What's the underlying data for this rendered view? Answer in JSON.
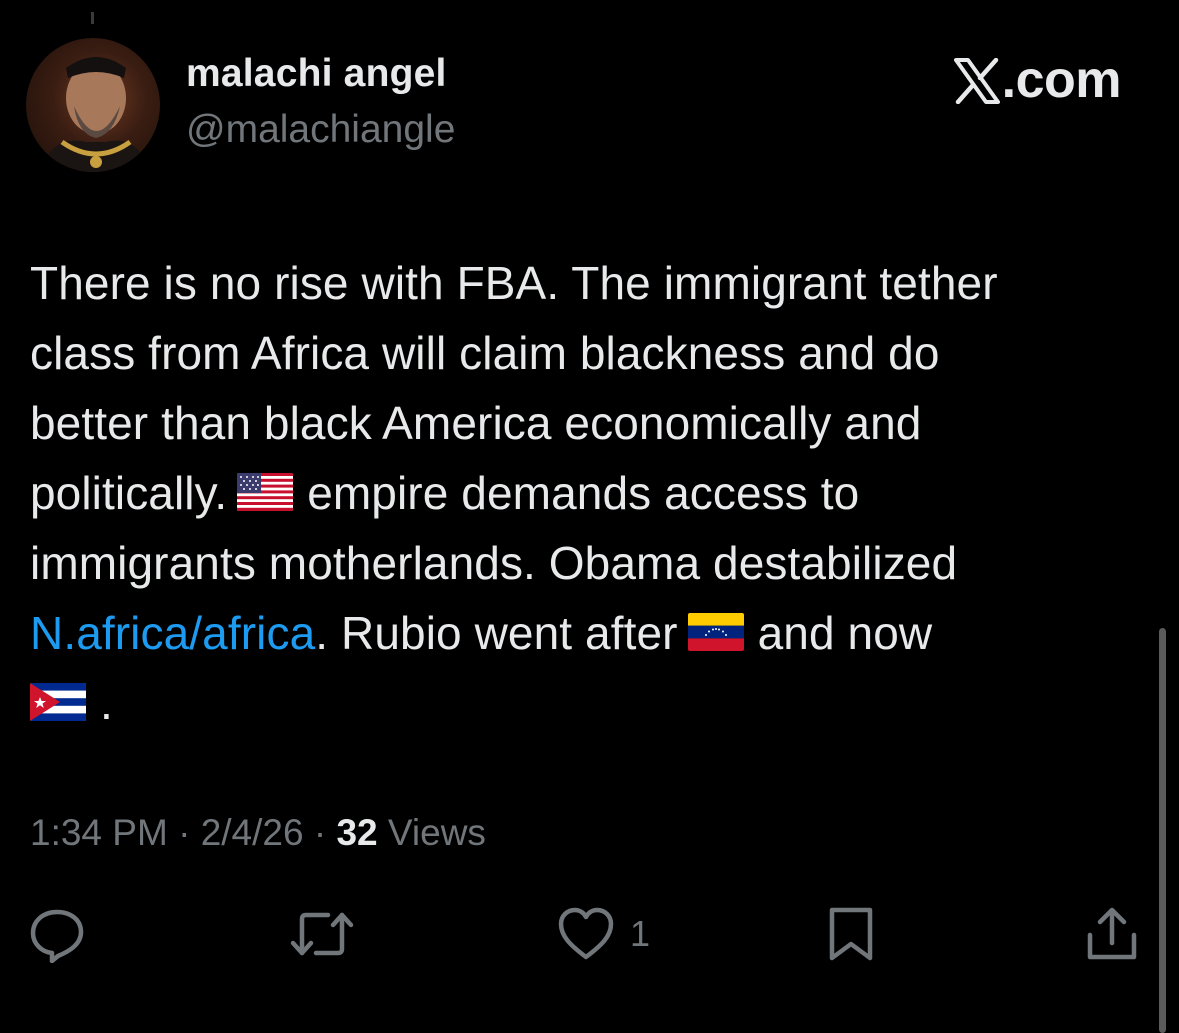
{
  "author": {
    "display_name": "malachi angel",
    "handle": "@malachiangle",
    "avatar_icon": "portrait-avatar"
  },
  "brand": {
    "label": ".com",
    "logo_icon": "x-logo-icon"
  },
  "tweet": {
    "line1": "There is no rise with FBA. The immigrant tether",
    "line2": "class from Africa will claim blackness and do",
    "line3": "better than black America economically and",
    "line4_before": "politically.",
    "line4_after": "empire demands access to",
    "line5": "immigrants motherlands. Obama destabilized",
    "line6_link": "N.africa/africa",
    "line6_middle": ". Rubio went after",
    "line6_after": "and now",
    "line7_after": ".",
    "flags": [
      "us-flag",
      "venezuela-flag",
      "cuba-flag"
    ]
  },
  "meta": {
    "time": "1:34 PM",
    "separator1": " · ",
    "date": "2/4/26",
    "separator2": " · ",
    "views_count": "32",
    "views_label": " Views"
  },
  "actions": {
    "reply_icon": "reply-icon",
    "retweet_icon": "retweet-icon",
    "like_icon": "heart-icon",
    "like_count": "1",
    "bookmark_icon": "bookmark-icon",
    "share_icon": "share-icon"
  },
  "colors": {
    "background": "#000000",
    "primary_text": "#e7e9ea",
    "secondary_text": "#71767b",
    "link": "#1d9bf0"
  }
}
